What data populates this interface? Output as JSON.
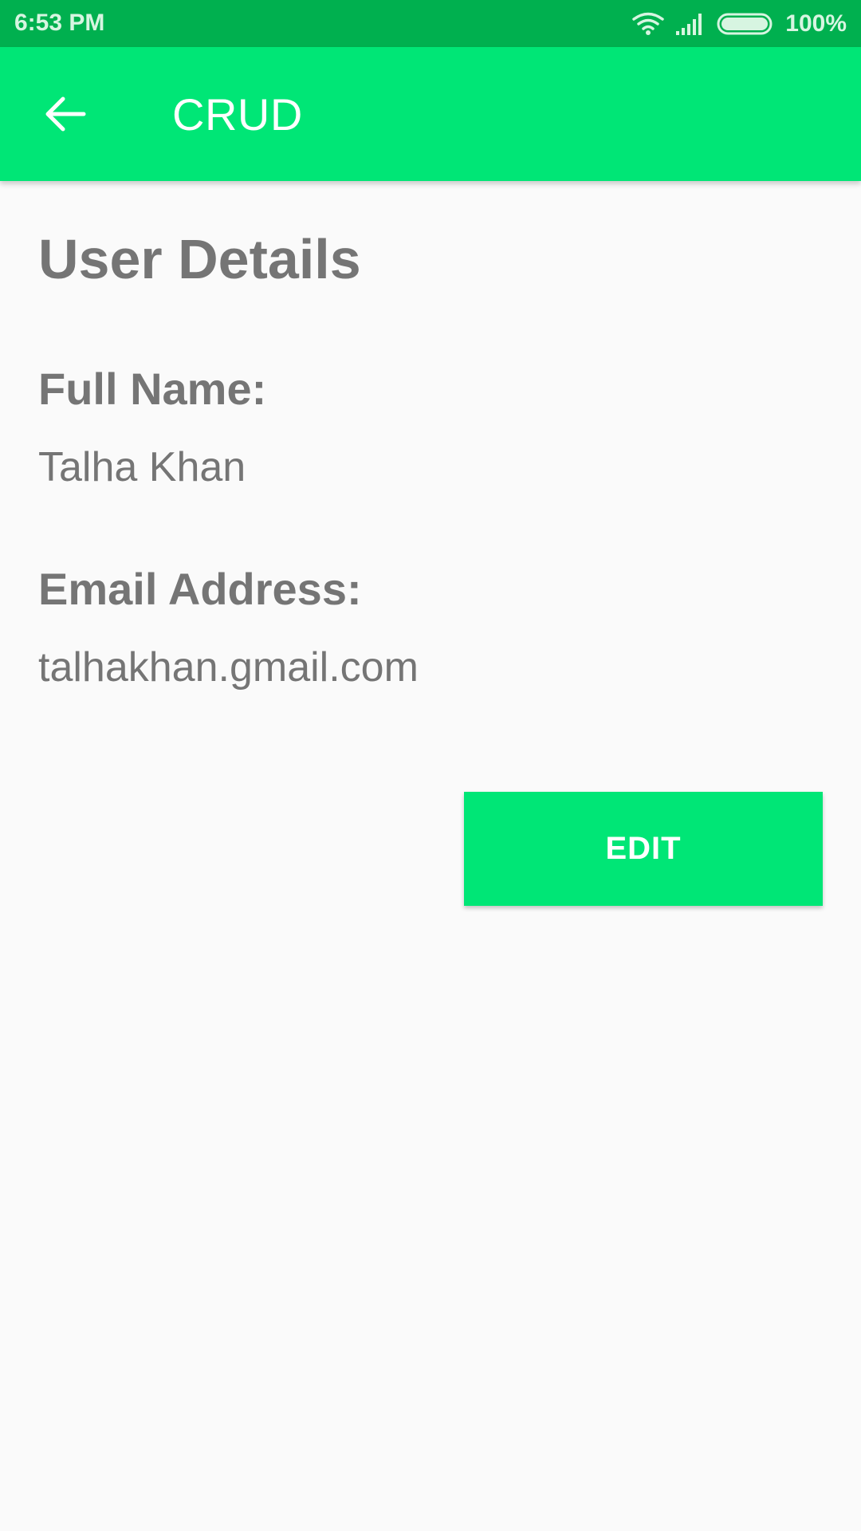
{
  "status_bar": {
    "time": "6:53 PM",
    "battery_percent": "100%",
    "icons": [
      "wifi-icon",
      "signal-icon",
      "battery-icon"
    ],
    "battery_level": 1.0
  },
  "app_bar": {
    "title": "CRUD",
    "back_icon": "arrow-back-icon",
    "color": "#00e676"
  },
  "details": {
    "heading": "User Details",
    "full_name_label": "Full Name:",
    "full_name_value": "Talha Khan",
    "email_label": "Email Address:",
    "email_value": "talhakhan.gmail.com"
  },
  "actions": {
    "edit_label": "EDIT"
  },
  "colors": {
    "status_bar": "#00b04f",
    "accent": "#00e676",
    "text": "#757575",
    "background": "#fafafa"
  }
}
